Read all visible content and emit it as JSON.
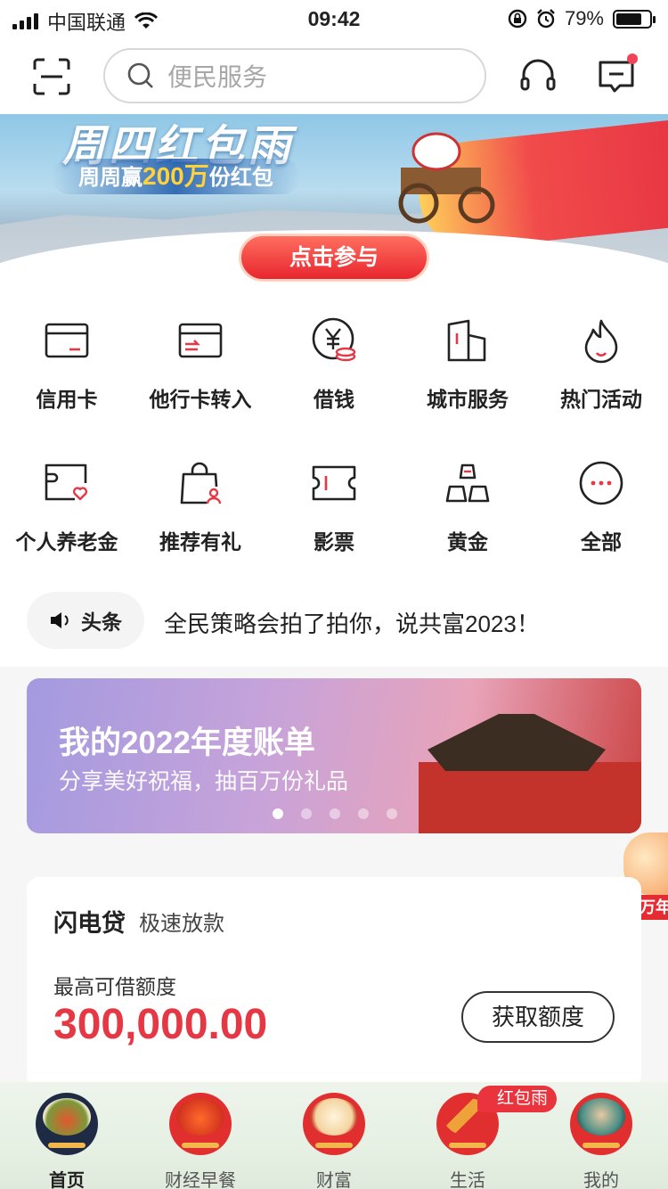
{
  "status_bar": {
    "carrier": "中国联通",
    "time": "09:42",
    "battery": "79%",
    "battery_level": 0.79,
    "icons": [
      "signal-icon",
      "wifi-icon",
      "orientation-lock-icon",
      "alarm-icon",
      "battery-icon"
    ]
  },
  "header": {
    "search_placeholder": "便民服务",
    "icons": [
      "scan-icon",
      "search-icon",
      "headset-icon",
      "message-icon"
    ]
  },
  "banner": {
    "title": "周四红包雨",
    "subtitle_prefix": "周周赢",
    "subtitle_highlight": "200万",
    "subtitle_suffix": "份红包",
    "cta_label": "点击参与"
  },
  "services": [
    {
      "label": "信用卡",
      "icon": "credit-card-icon"
    },
    {
      "label": "他行卡转入",
      "icon": "card-transfer-icon"
    },
    {
      "label": "借钱",
      "icon": "yuan-coin-icon"
    },
    {
      "label": "城市服务",
      "icon": "city-building-icon"
    },
    {
      "label": "热门活动",
      "icon": "flame-icon"
    },
    {
      "label": "个人养老金",
      "icon": "pension-card-icon"
    },
    {
      "label": "推荐有礼",
      "icon": "gift-bag-icon"
    },
    {
      "label": "影票",
      "icon": "ticket-icon"
    },
    {
      "label": "黄金",
      "icon": "gold-bars-icon"
    },
    {
      "label": "全部",
      "icon": "more-icon"
    }
  ],
  "headline": {
    "tag": "头条",
    "text": "全民策略会拍了拍你，说共富2023！"
  },
  "promo": {
    "title": "我的2022年度账单",
    "subtitle": "分享美好祝福，抽百万份礼品",
    "page_count": 5,
    "active_page": 1
  },
  "floating": {
    "label": "千万年"
  },
  "loan": {
    "title": "闪电贷",
    "tagline": "极速放款",
    "limit_label": "最高可借额度",
    "amount": "300,000.00",
    "button": "获取额度"
  },
  "tabbar": {
    "tabs": [
      {
        "label": "首页",
        "active": true
      },
      {
        "label": "财经早餐",
        "active": false
      },
      {
        "label": "财富",
        "active": false
      },
      {
        "label": "生活",
        "active": false,
        "badge": "红包雨"
      },
      {
        "label": "我的",
        "active": false
      }
    ]
  },
  "colors": {
    "accent": "#e63744",
    "badge": "#f0445a",
    "text": "#222222"
  }
}
